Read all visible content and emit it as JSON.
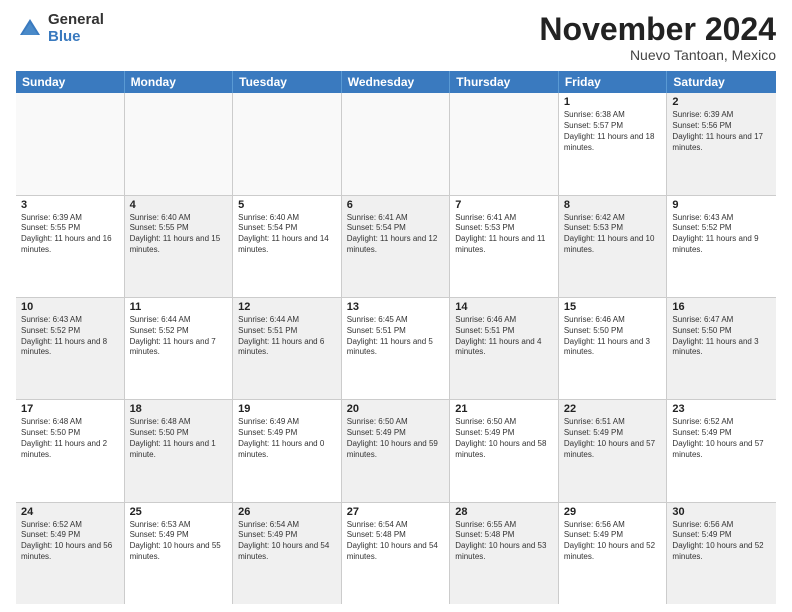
{
  "logo": {
    "general": "General",
    "blue": "Blue"
  },
  "title": "November 2024",
  "location": "Nuevo Tantoan, Mexico",
  "header_days": [
    "Sunday",
    "Monday",
    "Tuesday",
    "Wednesday",
    "Thursday",
    "Friday",
    "Saturday"
  ],
  "rows": [
    [
      {
        "day": "",
        "info": "",
        "empty": true
      },
      {
        "day": "",
        "info": "",
        "empty": true
      },
      {
        "day": "",
        "info": "",
        "empty": true
      },
      {
        "day": "",
        "info": "",
        "empty": true
      },
      {
        "day": "",
        "info": "",
        "empty": true
      },
      {
        "day": "1",
        "info": "Sunrise: 6:38 AM\nSunset: 5:57 PM\nDaylight: 11 hours and 18 minutes.",
        "empty": false,
        "shaded": false
      },
      {
        "day": "2",
        "info": "Sunrise: 6:39 AM\nSunset: 5:56 PM\nDaylight: 11 hours and 17 minutes.",
        "empty": false,
        "shaded": true
      }
    ],
    [
      {
        "day": "3",
        "info": "Sunrise: 6:39 AM\nSunset: 5:55 PM\nDaylight: 11 hours and 16 minutes.",
        "empty": false,
        "shaded": false
      },
      {
        "day": "4",
        "info": "Sunrise: 6:40 AM\nSunset: 5:55 PM\nDaylight: 11 hours and 15 minutes.",
        "empty": false,
        "shaded": true
      },
      {
        "day": "5",
        "info": "Sunrise: 6:40 AM\nSunset: 5:54 PM\nDaylight: 11 hours and 14 minutes.",
        "empty": false,
        "shaded": false
      },
      {
        "day": "6",
        "info": "Sunrise: 6:41 AM\nSunset: 5:54 PM\nDaylight: 11 hours and 12 minutes.",
        "empty": false,
        "shaded": true
      },
      {
        "day": "7",
        "info": "Sunrise: 6:41 AM\nSunset: 5:53 PM\nDaylight: 11 hours and 11 minutes.",
        "empty": false,
        "shaded": false
      },
      {
        "day": "8",
        "info": "Sunrise: 6:42 AM\nSunset: 5:53 PM\nDaylight: 11 hours and 10 minutes.",
        "empty": false,
        "shaded": true
      },
      {
        "day": "9",
        "info": "Sunrise: 6:43 AM\nSunset: 5:52 PM\nDaylight: 11 hours and 9 minutes.",
        "empty": false,
        "shaded": false
      }
    ],
    [
      {
        "day": "10",
        "info": "Sunrise: 6:43 AM\nSunset: 5:52 PM\nDaylight: 11 hours and 8 minutes.",
        "empty": false,
        "shaded": true
      },
      {
        "day": "11",
        "info": "Sunrise: 6:44 AM\nSunset: 5:52 PM\nDaylight: 11 hours and 7 minutes.",
        "empty": false,
        "shaded": false
      },
      {
        "day": "12",
        "info": "Sunrise: 6:44 AM\nSunset: 5:51 PM\nDaylight: 11 hours and 6 minutes.",
        "empty": false,
        "shaded": true
      },
      {
        "day": "13",
        "info": "Sunrise: 6:45 AM\nSunset: 5:51 PM\nDaylight: 11 hours and 5 minutes.",
        "empty": false,
        "shaded": false
      },
      {
        "day": "14",
        "info": "Sunrise: 6:46 AM\nSunset: 5:51 PM\nDaylight: 11 hours and 4 minutes.",
        "empty": false,
        "shaded": true
      },
      {
        "day": "15",
        "info": "Sunrise: 6:46 AM\nSunset: 5:50 PM\nDaylight: 11 hours and 3 minutes.",
        "empty": false,
        "shaded": false
      },
      {
        "day": "16",
        "info": "Sunrise: 6:47 AM\nSunset: 5:50 PM\nDaylight: 11 hours and 3 minutes.",
        "empty": false,
        "shaded": true
      }
    ],
    [
      {
        "day": "17",
        "info": "Sunrise: 6:48 AM\nSunset: 5:50 PM\nDaylight: 11 hours and 2 minutes.",
        "empty": false,
        "shaded": false
      },
      {
        "day": "18",
        "info": "Sunrise: 6:48 AM\nSunset: 5:50 PM\nDaylight: 11 hours and 1 minute.",
        "empty": false,
        "shaded": true
      },
      {
        "day": "19",
        "info": "Sunrise: 6:49 AM\nSunset: 5:49 PM\nDaylight: 11 hours and 0 minutes.",
        "empty": false,
        "shaded": false
      },
      {
        "day": "20",
        "info": "Sunrise: 6:50 AM\nSunset: 5:49 PM\nDaylight: 10 hours and 59 minutes.",
        "empty": false,
        "shaded": true
      },
      {
        "day": "21",
        "info": "Sunrise: 6:50 AM\nSunset: 5:49 PM\nDaylight: 10 hours and 58 minutes.",
        "empty": false,
        "shaded": false
      },
      {
        "day": "22",
        "info": "Sunrise: 6:51 AM\nSunset: 5:49 PM\nDaylight: 10 hours and 57 minutes.",
        "empty": false,
        "shaded": true
      },
      {
        "day": "23",
        "info": "Sunrise: 6:52 AM\nSunset: 5:49 PM\nDaylight: 10 hours and 57 minutes.",
        "empty": false,
        "shaded": false
      }
    ],
    [
      {
        "day": "24",
        "info": "Sunrise: 6:52 AM\nSunset: 5:49 PM\nDaylight: 10 hours and 56 minutes.",
        "empty": false,
        "shaded": true
      },
      {
        "day": "25",
        "info": "Sunrise: 6:53 AM\nSunset: 5:49 PM\nDaylight: 10 hours and 55 minutes.",
        "empty": false,
        "shaded": false
      },
      {
        "day": "26",
        "info": "Sunrise: 6:54 AM\nSunset: 5:49 PM\nDaylight: 10 hours and 54 minutes.",
        "empty": false,
        "shaded": true
      },
      {
        "day": "27",
        "info": "Sunrise: 6:54 AM\nSunset: 5:48 PM\nDaylight: 10 hours and 54 minutes.",
        "empty": false,
        "shaded": false
      },
      {
        "day": "28",
        "info": "Sunrise: 6:55 AM\nSunset: 5:48 PM\nDaylight: 10 hours and 53 minutes.",
        "empty": false,
        "shaded": true
      },
      {
        "day": "29",
        "info": "Sunrise: 6:56 AM\nSunset: 5:49 PM\nDaylight: 10 hours and 52 minutes.",
        "empty": false,
        "shaded": false
      },
      {
        "day": "30",
        "info": "Sunrise: 6:56 AM\nSunset: 5:49 PM\nDaylight: 10 hours and 52 minutes.",
        "empty": false,
        "shaded": true
      }
    ]
  ]
}
